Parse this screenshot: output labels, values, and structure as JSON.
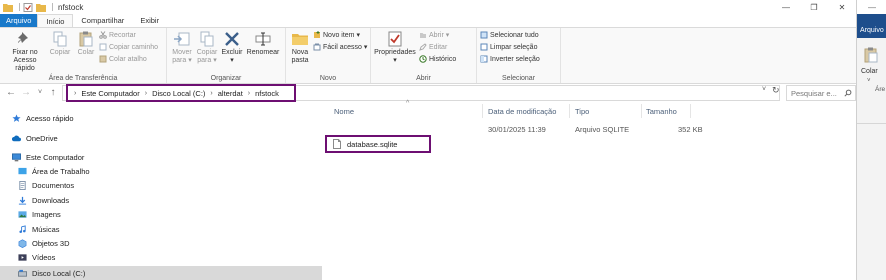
{
  "window": {
    "title": "nfstock",
    "controls": {
      "minimize": "—",
      "maximize": "❐",
      "close": "✕"
    }
  },
  "ribbon_tabs": [
    {
      "label": "Arquivo"
    },
    {
      "label": "Início"
    },
    {
      "label": "Compartilhar"
    },
    {
      "label": "Exibir"
    }
  ],
  "ribbon": {
    "clipboard": {
      "label": "Área de Transferência",
      "pin_line1": "Fixar no",
      "pin_line2": "Acesso rápido",
      "copy": "Copiar",
      "paste": "Colar",
      "cut": "Recortar",
      "copy_path": "Copiar caminho",
      "paste_shortcut": "Colar atalho"
    },
    "organize": {
      "label": "Organizar",
      "move_line1": "Mover",
      "move_line2": "para ▾",
      "copy_line1": "Copiar",
      "copy_line2": "para ▾",
      "delete": "Excluir",
      "delete_dd": "▾",
      "rename": "Renomear"
    },
    "new": {
      "label": "Novo",
      "folder_line1": "Nova",
      "folder_line2": "pasta",
      "new_item": "Novo item ▾",
      "easy_access": "Fácil acesso ▾"
    },
    "open": {
      "label": "Abrir",
      "properties": "Propriedades",
      "properties_dd": "▾",
      "open": "Abrir ▾",
      "edit": "Editar",
      "history": "Histórico"
    },
    "select": {
      "label": "Selecionar",
      "select_all": "Selecionar tudo",
      "clear": "Limpar seleção",
      "invert": "Inverter seleção"
    }
  },
  "address": {
    "crumbs": [
      "Este Computador",
      "Disco Local (C:)",
      "alterdat",
      "nfstock"
    ],
    "search_placeholder": "Pesquisar e..."
  },
  "nav_pane": [
    {
      "label": "Acesso rápido",
      "icon": "star-icon",
      "indent": 0
    },
    {
      "label": "OneDrive",
      "icon": "cloud-icon",
      "indent": 0
    },
    {
      "label": "Este Computador",
      "icon": "computer-icon",
      "indent": 0
    },
    {
      "label": "Área de Trabalho",
      "icon": "desktop-folder-icon",
      "indent": 1
    },
    {
      "label": "Documentos",
      "icon": "documents-folder-icon",
      "indent": 1
    },
    {
      "label": "Downloads",
      "icon": "downloads-folder-icon",
      "indent": 1
    },
    {
      "label": "Imagens",
      "icon": "pictures-folder-icon",
      "indent": 1
    },
    {
      "label": "Músicas",
      "icon": "music-folder-icon",
      "indent": 1
    },
    {
      "label": "Objetos 3D",
      "icon": "3d-objects-folder-icon",
      "indent": 1
    },
    {
      "label": "Vídeos",
      "icon": "videos-folder-icon",
      "indent": 1
    },
    {
      "label": "Disco Local (C:)",
      "icon": "drive-icon",
      "indent": 1
    }
  ],
  "file_list": {
    "columns": [
      "Nome",
      "Data de modificação",
      "Tipo",
      "Tamanho"
    ],
    "rows": [
      {
        "name": "database.sqlite",
        "modified": "30/01/2025 11:39",
        "type": "Arquivo SQLITE",
        "size": "352 KB"
      }
    ]
  },
  "second_window": {
    "file_tab": "Arquivo",
    "paste": "Colar",
    "area": "Áre"
  },
  "colors": {
    "file_tab": "#1979ca",
    "highlight_box": "#6d0f72",
    "nav_selected": "#cce8ff",
    "second_window_file": "#1e4e8c"
  }
}
